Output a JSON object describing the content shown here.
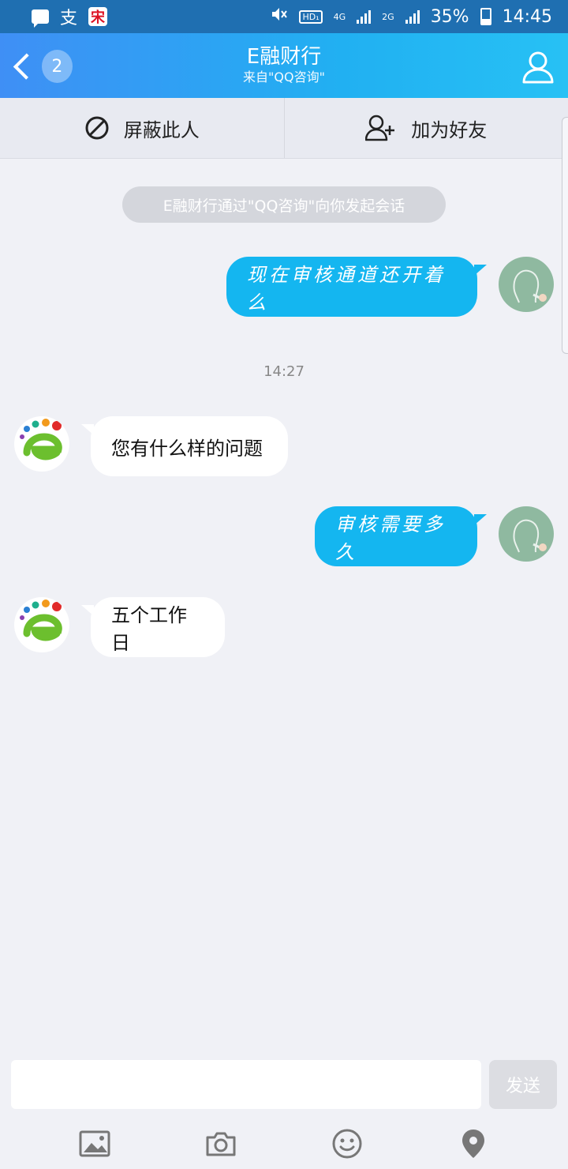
{
  "status_bar": {
    "carrier_glyph": "支",
    "app_glyph": "宋",
    "hd_label": "HD₁",
    "net_4g": "4G",
    "net_2g": "2G",
    "battery": "35%",
    "time": "14:45"
  },
  "header": {
    "unread_count": "2",
    "title": "E融财行",
    "subtitle": "来自\"QQ咨询\""
  },
  "actions": {
    "block_label": "屏蔽此人",
    "add_friend_label": "加为好友"
  },
  "system_message": "E融财行通过\"QQ咨询\"向你发起会话",
  "timestamp": "14:27",
  "messages": [
    {
      "direction": "out",
      "text": "现在审核通道还开着么"
    },
    {
      "direction": "in",
      "text": "您有什么样的问题"
    },
    {
      "direction": "out",
      "text": "审核需要多久"
    },
    {
      "direction": "in",
      "text": "五个工作日"
    }
  ],
  "composer": {
    "placeholder": "",
    "send_label": "发送"
  },
  "colors": {
    "accent": "#14b6f0",
    "header_gradient_start": "#3f8ff5",
    "header_gradient_end": "#27c1f4"
  },
  "toolbar_icons": [
    "image-icon",
    "camera-icon",
    "emoji-icon",
    "location-icon"
  ]
}
